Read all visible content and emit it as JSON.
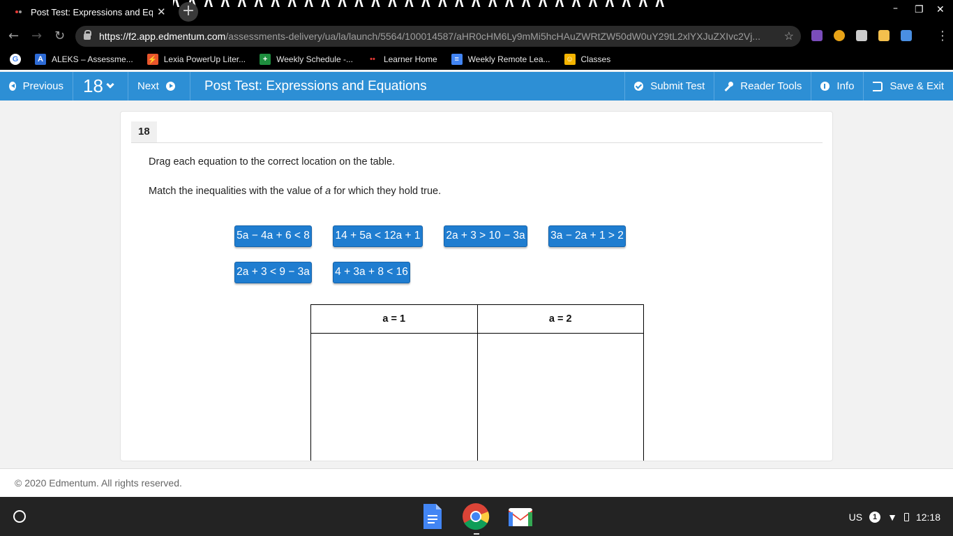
{
  "browser": {
    "tab_title": "Post Test: Expressions and Equa",
    "url_host": "https://f2.app.edmentum.com",
    "url_path": "/assessments-delivery/ua/la/launch/5564/100014587/aHR0cHM6Ly9mMi5hcHAuZWRtZW50dW0uY29tL2xlYXJuZXIvc2Vj...",
    "bookmarks": [
      {
        "label": "ALEKS – Assessme...",
        "icon": "aleks-icon",
        "color": "#2d6bd6"
      },
      {
        "label": "Lexia PowerUp Liter...",
        "icon": "lexia-icon",
        "color": "#e8552c"
      },
      {
        "label": "Weekly Schedule -...",
        "icon": "sheets-icon",
        "color": "#1e8e3e"
      },
      {
        "label": "Learner Home",
        "icon": "edmentum-icon",
        "color": "#e53935"
      },
      {
        "label": "Weekly Remote Lea...",
        "icon": "docs-icon",
        "color": "#4285f4"
      },
      {
        "label": "Classes",
        "icon": "classroom-icon",
        "color": "#f4b400"
      }
    ]
  },
  "ebar": {
    "previous": "Previous",
    "question_number": "18",
    "next": "Next",
    "title": "Post Test: Expressions and Equations",
    "submit": "Submit Test",
    "reader_tools": "Reader Tools",
    "info": "Info",
    "save_exit": "Save & Exit",
    "accent": "#2d8fd5"
  },
  "question": {
    "number": "18",
    "instruction1": "Drag each equation to the correct location on the table.",
    "instruction2_pre": "Match the inequalities with the value of ",
    "instruction2_var": "a",
    "instruction2_post": " for which they hold true.",
    "tiles": [
      "5a − 4a + 6 < 8",
      "14 + 5a < 12a + 1",
      "2a + 3 > 10 − 3a",
      "3a − 2a + 1 > 2",
      "2a + 3 < 9 − 3a",
      "4 + 3a + 8 < 16"
    ],
    "table_headers": [
      "a = 1",
      "a = 2"
    ]
  },
  "footer": {
    "copyright": "© 2020 Edmentum. All rights reserved."
  },
  "shelf": {
    "locale": "US",
    "notification_count": "1",
    "time": "12:18"
  }
}
